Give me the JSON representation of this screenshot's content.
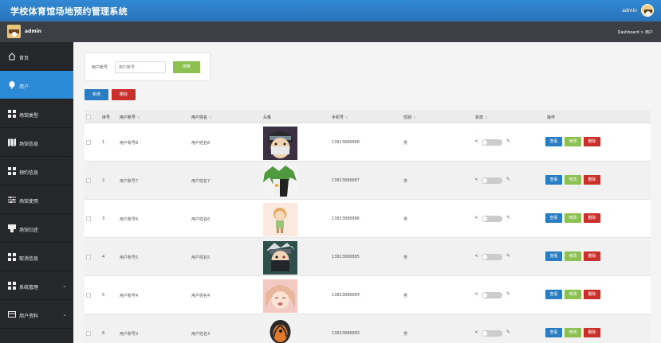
{
  "header": {
    "title": "学校体育馆场地预约管理系统",
    "username": "admin"
  },
  "subheader": {
    "username": "admin",
    "breadcrumb": "Dashboard > 用户"
  },
  "sidebar": {
    "items": [
      {
        "label": "首页",
        "icon": "home-icon"
      },
      {
        "label": "用户",
        "icon": "balloon-icon"
      },
      {
        "label": "场馆类型",
        "icon": "grid-icon"
      },
      {
        "label": "场馆信息",
        "icon": "map-icon"
      },
      {
        "label": "预约信息",
        "icon": "grid-icon"
      },
      {
        "label": "场馆使用",
        "icon": "sliders-icon"
      },
      {
        "label": "场馆归还",
        "icon": "stamp-icon"
      },
      {
        "label": "取消信息",
        "icon": "grid-icon"
      },
      {
        "label": "系统管理",
        "icon": "grid-icon"
      },
      {
        "label": "用户资料",
        "icon": "card-icon"
      }
    ]
  },
  "search": {
    "label": "用户账号",
    "placeholder": "用户账号",
    "button": "搜索"
  },
  "actions": {
    "add": "新增",
    "delete": "删除"
  },
  "table": {
    "headers": [
      "序号",
      "用户账号",
      "用户姓名",
      "头像",
      "手机号",
      "性别",
      "状态",
      "操作"
    ],
    "rows": [
      {
        "index": "1",
        "account": "用户账号8",
        "name": "用户姓名8",
        "phone": "13823888888",
        "gender": "男"
      },
      {
        "index": "2",
        "account": "用户账号7",
        "name": "用户姓名7",
        "phone": "13823888887",
        "gender": "男"
      },
      {
        "index": "3",
        "account": "用户账号6",
        "name": "用户姓名6",
        "phone": "13823888886",
        "gender": "男"
      },
      {
        "index": "4",
        "account": "用户账号5",
        "name": "用户姓名5",
        "phone": "13823888885",
        "gender": "男"
      },
      {
        "index": "5",
        "account": "用户账号4",
        "name": "用户姓名4",
        "phone": "13823888884",
        "gender": "男"
      },
      {
        "index": "6",
        "account": "用户账号3",
        "name": "用户姓名3",
        "phone": "13823888883",
        "gender": "男"
      }
    ],
    "row_buttons": {
      "view": "查看",
      "edit": "修改",
      "delete": "删除"
    }
  },
  "colors": {
    "primary": "#2b7dc3",
    "success": "#8cc152",
    "danger": "#c9302c",
    "sidebar": "#25272b"
  }
}
